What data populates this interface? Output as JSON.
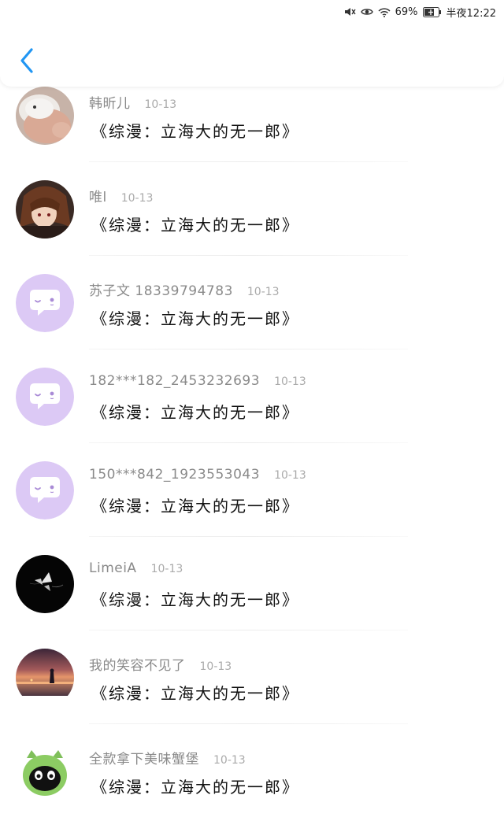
{
  "status_bar": {
    "battery": "69%",
    "time": "半夜12:22",
    "icons": [
      "mute-icon",
      "eye-icon",
      "wifi-icon",
      "battery-icon"
    ]
  },
  "header": {
    "back_icon": "chevron-left-icon",
    "accent_color": "#2196f3"
  },
  "items": [
    {
      "username": "韩昕儿",
      "date": "10-13",
      "content": "《综漫：立海大的无一郎》",
      "avatar": "photo-hamster"
    },
    {
      "username": "唯l",
      "date": "10-13",
      "content": "《综漫：立海大的无一郎》",
      "avatar": "photo-anime"
    },
    {
      "username": "苏子文 18339794783",
      "date": "10-13",
      "content": "《综漫：立海大的无一郎》",
      "avatar": "default-chat"
    },
    {
      "username": "182***182_2453232693",
      "date": "10-13",
      "content": "《综漫：立海大的无一郎》",
      "avatar": "default-chat"
    },
    {
      "username": "150***842_1923553043",
      "date": "10-13",
      "content": "《综漫：立海大的无一郎》",
      "avatar": "default-chat"
    },
    {
      "username": "LimeiA",
      "date": "10-13",
      "content": "《综漫：立海大的无一郎》",
      "avatar": "photo-butterfly"
    },
    {
      "username": "我的笑容不见了",
      "date": "10-13",
      "content": "《综漫：立海大的无一郎》",
      "avatar": "photo-sunset"
    },
    {
      "username": "全款拿下美味蟹堡",
      "date": "10-13",
      "content": "《综漫：立海大的无一郎》",
      "avatar": "photo-cat"
    }
  ]
}
